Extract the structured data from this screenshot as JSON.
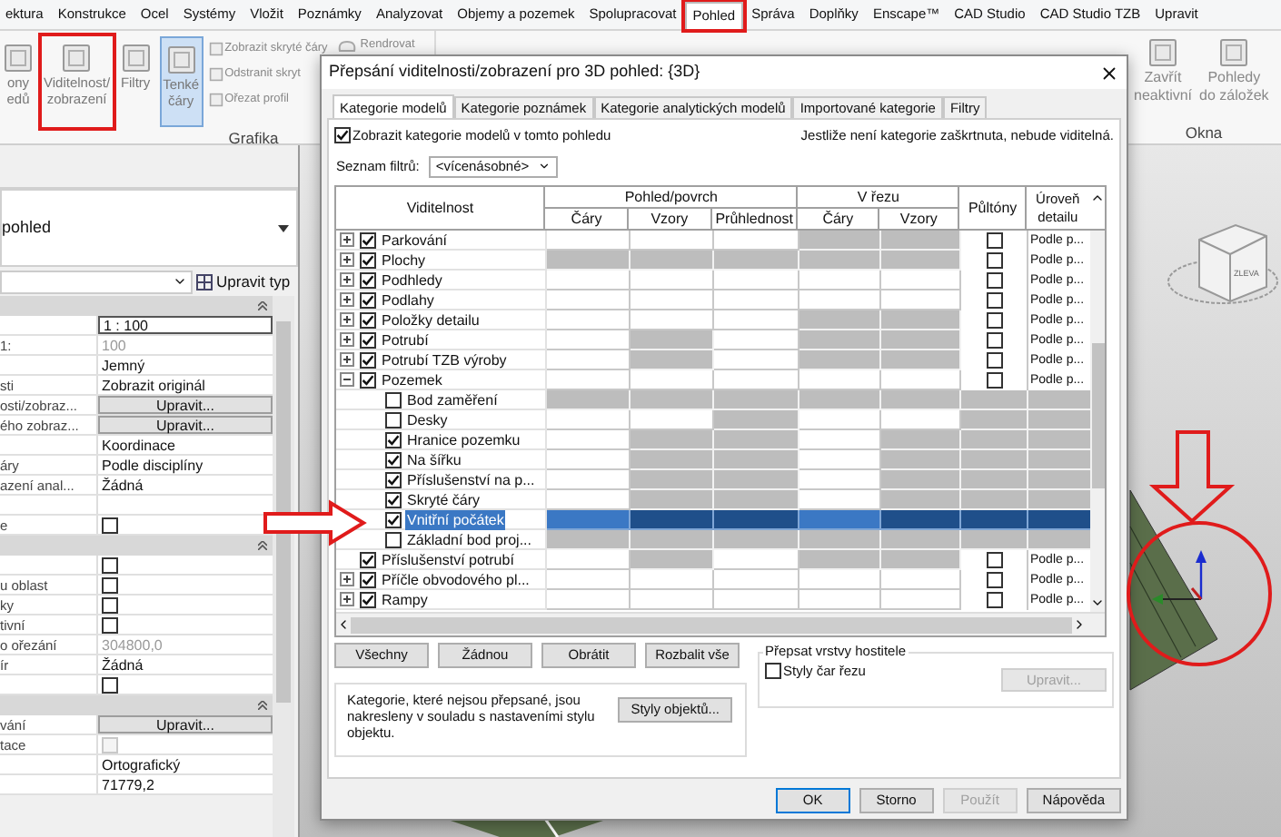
{
  "ribbon": {
    "tabs": [
      {
        "label": "ektura",
        "selected": false,
        "annotated": false
      },
      {
        "label": "Konstrukce",
        "selected": false,
        "annotated": false
      },
      {
        "label": "Ocel",
        "selected": false,
        "annotated": false
      },
      {
        "label": "Systémy",
        "selected": false,
        "annotated": false
      },
      {
        "label": "Vložit",
        "selected": false,
        "annotated": false
      },
      {
        "label": "Poznámky",
        "selected": false,
        "annotated": false
      },
      {
        "label": "Analyzovat",
        "selected": false,
        "annotated": false
      },
      {
        "label": "Objemy a pozemek",
        "selected": false,
        "annotated": false
      },
      {
        "label": "Spolupracovat",
        "selected": false,
        "annotated": false
      },
      {
        "label": "Pohled",
        "selected": true,
        "annotated": true
      },
      {
        "label": "Správa",
        "selected": false,
        "annotated": false
      },
      {
        "label": "Doplňky",
        "selected": false,
        "annotated": false
      },
      {
        "label": "Enscape™",
        "selected": false,
        "annotated": false
      },
      {
        "label": "CAD Studio",
        "selected": false,
        "annotated": false
      },
      {
        "label": "CAD Studio TZB",
        "selected": false,
        "annotated": false
      },
      {
        "label": "Upravit",
        "selected": false,
        "annotated": false
      }
    ],
    "graphics_panel": {
      "label": "Grafika",
      "large_buttons": [
        {
          "label": "ony\nedů",
          "selected": false,
          "annotated": false
        },
        {
          "label": "Viditelnost/\nzobrazení",
          "selected": false,
          "annotated": true
        },
        {
          "label": "Filtry",
          "selected": false,
          "annotated": false
        },
        {
          "label": "Tenké\nčáry",
          "selected": true,
          "annotated": false
        }
      ],
      "small_buttons": [
        "Zobrazit skryté čáry",
        "Odstranit skryt",
        "Ořezat profil"
      ],
      "render_button": "Rendrovat"
    },
    "windows_panel": {
      "label": "Okna",
      "buttons": [
        "Zavřít\nneaktivní",
        "Pohledy\ndo záložek"
      ]
    }
  },
  "properties": {
    "type_name": "pohled",
    "edit_type": "Upravit typ",
    "sections": [
      {
        "rows": [
          {
            "kind": "input",
            "value": "1 : 100",
            "disabled": false
          },
          {
            "kind": "text",
            "label": "1:",
            "value": "100",
            "disabled": true
          },
          {
            "kind": "text",
            "value": "Jemný",
            "disabled": false
          },
          {
            "kind": "text",
            "label": "sti",
            "value": "Zobrazit originál",
            "disabled": false
          },
          {
            "kind": "button",
            "label": "osti/zobraz...",
            "value": "Upravit...",
            "disabled": false
          },
          {
            "kind": "button",
            "label": "ého zobraz...",
            "value": "Upravit...",
            "disabled": false
          },
          {
            "kind": "text",
            "value": "Koordinace",
            "disabled": false
          },
          {
            "kind": "text",
            "label": "áry",
            "value": "Podle disciplíny",
            "disabled": false
          },
          {
            "kind": "text",
            "label": "azení anal...",
            "value": "Žádná",
            "disabled": false
          },
          {
            "kind": "text"
          },
          {
            "kind": "checkbox",
            "label": "e",
            "checked": false,
            "disabled": false
          }
        ]
      },
      {
        "rows": [
          {
            "kind": "checkbox",
            "checked": false,
            "disabled": false
          },
          {
            "kind": "checkbox",
            "label": "u oblast",
            "checked": false,
            "disabled": false
          },
          {
            "kind": "checkbox",
            "label": "ky",
            "checked": false,
            "disabled": false
          },
          {
            "kind": "checkbox",
            "label": "tivní",
            "checked": false,
            "disabled": false
          },
          {
            "kind": "text",
            "label": "o ořezání",
            "value": "304800,0",
            "disabled": true
          },
          {
            "kind": "text",
            "label": "ír",
            "value": "Žádná",
            "disabled": false
          },
          {
            "kind": "checkbox",
            "checked": false,
            "disabled": false
          }
        ]
      },
      {
        "rows": [
          {
            "kind": "button",
            "label": "vání",
            "value": "Upravit...",
            "disabled": false
          },
          {
            "kind": "checkbox",
            "label": "tace",
            "checked": false,
            "disabled": true
          },
          {
            "kind": "text",
            "value": "Ortografický",
            "disabled": false
          },
          {
            "kind": "text",
            "value": "71779,2",
            "disabled": false
          }
        ]
      }
    ]
  },
  "view_cube": {
    "face": "ZLEVA"
  },
  "dialog": {
    "title": "Přepsání viditelnosti/zobrazení pro 3D pohled: {3D}",
    "tabs": [
      {
        "label": "Kategorie modelů",
        "selected": true
      },
      {
        "label": "Kategorie poznámek",
        "selected": false
      },
      {
        "label": "Kategorie analytických modelů",
        "selected": false
      },
      {
        "label": "Importované kategorie",
        "selected": false
      },
      {
        "label": "Filtry",
        "selected": false
      }
    ],
    "show_categories": {
      "label": "Zobrazit kategorie modelů v tomto pohledu",
      "checked": true
    },
    "hint": "Jestliže není kategorie zaškrtnuta, nebude viditelná.",
    "filter_list": {
      "label": "Seznam filtrů:",
      "value": "<vícenásobné>"
    },
    "columns": {
      "visibility": "Viditelnost",
      "surface": "Pohled/povrch",
      "surface_sub": [
        "Čáry",
        "Vzory",
        "Průhlednost"
      ],
      "cut": "V řezu",
      "cut_sub": [
        "Čáry",
        "Vzory"
      ],
      "halftone": "Půltóny",
      "detail": "Úroveň\ndetailu"
    },
    "rows": [
      {
        "label": "Parkování",
        "checked": true,
        "expanded": false,
        "selected": false,
        "cells": [
          {
            "disabled": false
          },
          {
            "disabled": false
          },
          {
            "disabled": false
          },
          {
            "disabled": true
          },
          {
            "disabled": true
          }
        ],
        "halftone": false,
        "detail": "Podle p..."
      },
      {
        "label": "Plochy",
        "checked": true,
        "expanded": false,
        "selected": false,
        "cells": [
          {
            "disabled": true
          },
          {
            "disabled": true
          },
          {
            "disabled": true
          },
          {
            "disabled": true
          },
          {
            "disabled": true
          }
        ],
        "halftone": false,
        "detail": "Podle p..."
      },
      {
        "label": "Podhledy",
        "checked": true,
        "expanded": false,
        "selected": false,
        "cells": [
          {
            "disabled": false
          },
          {
            "disabled": false
          },
          {
            "disabled": false
          },
          {
            "disabled": false
          },
          {
            "disabled": false
          }
        ],
        "halftone": false,
        "detail": "Podle p..."
      },
      {
        "label": "Podlahy",
        "checked": true,
        "expanded": false,
        "selected": false,
        "cells": [
          {
            "disabled": false
          },
          {
            "disabled": false
          },
          {
            "disabled": false
          },
          {
            "disabled": false
          },
          {
            "disabled": false
          }
        ],
        "halftone": false,
        "detail": "Podle p..."
      },
      {
        "label": "Položky detailu",
        "checked": true,
        "expanded": false,
        "selected": false,
        "cells": [
          {
            "disabled": false
          },
          {
            "disabled": false
          },
          {
            "disabled": false
          },
          {
            "disabled": true
          },
          {
            "disabled": true
          }
        ],
        "halftone": false,
        "detail": "Podle p..."
      },
      {
        "label": "Potrubí",
        "checked": true,
        "expanded": false,
        "selected": false,
        "cells": [
          {
            "disabled": false
          },
          {
            "disabled": true
          },
          {
            "disabled": false
          },
          {
            "disabled": true
          },
          {
            "disabled": true
          }
        ],
        "halftone": false,
        "detail": "Podle p..."
      },
      {
        "label": "Potrubí TZB výroby",
        "checked": true,
        "expanded": false,
        "selected": false,
        "cells": [
          {
            "disabled": false
          },
          {
            "disabled": true
          },
          {
            "disabled": false
          },
          {
            "disabled": true
          },
          {
            "disabled": true
          }
        ],
        "halftone": false,
        "detail": "Podle p..."
      },
      {
        "label": "Pozemek",
        "checked": true,
        "expanded": true,
        "selected": false,
        "cells": [
          {
            "disabled": false
          },
          {
            "disabled": false
          },
          {
            "disabled": false
          },
          {
            "disabled": false
          },
          {
            "disabled": false
          }
        ],
        "halftone": false,
        "detail": "Podle p...",
        "children": [
          {
            "label": "Bod zaměření",
            "checked": false,
            "selected": false,
            "cells": [
              {
                "disabled": true
              },
              {
                "disabled": true
              },
              {
                "disabled": true
              },
              {
                "disabled": true
              },
              {
                "disabled": true
              }
            ]
          },
          {
            "label": "Desky",
            "checked": false,
            "selected": false,
            "cells": [
              {
                "disabled": false
              },
              {
                "disabled": false
              },
              {
                "disabled": true
              },
              {
                "disabled": false
              },
              {
                "disabled": false
              }
            ]
          },
          {
            "label": "Hranice pozemku",
            "checked": true,
            "selected": false,
            "cells": [
              {
                "disabled": false
              },
              {
                "disabled": true
              },
              {
                "disabled": true
              },
              {
                "disabled": false
              },
              {
                "disabled": true
              }
            ]
          },
          {
            "label": "Na šířku",
            "checked": true,
            "selected": false,
            "cells": [
              {
                "disabled": false
              },
              {
                "disabled": true
              },
              {
                "disabled": true
              },
              {
                "disabled": false
              },
              {
                "disabled": true
              }
            ]
          },
          {
            "label": "Příslušenství na p...",
            "checked": true,
            "selected": false,
            "cells": [
              {
                "disabled": false
              },
              {
                "disabled": true
              },
              {
                "disabled": true
              },
              {
                "disabled": false
              },
              {
                "disabled": true
              }
            ]
          },
          {
            "label": "Skryté čáry",
            "checked": true,
            "selected": false,
            "cells": [
              {
                "disabled": false
              },
              {
                "disabled": true
              },
              {
                "disabled": true
              },
              {
                "disabled": false
              },
              {
                "disabled": true
              }
            ]
          },
          {
            "label": "Vnitřní počátek",
            "checked": true,
            "selected": true,
            "cells": [
              {
                "disabled": false
              },
              {
                "disabled": true
              },
              {
                "disabled": true
              },
              {
                "disabled": false
              },
              {
                "disabled": true
              }
            ]
          },
          {
            "label": "Základní bod proj...",
            "checked": false,
            "selected": false,
            "cells": [
              {
                "disabled": true
              },
              {
                "disabled": true
              },
              {
                "disabled": true
              },
              {
                "disabled": true
              },
              {
                "disabled": true
              }
            ]
          }
        ]
      },
      {
        "label": "Příslušenství potrubí",
        "checked": true,
        "selected": false,
        "cells": [
          {
            "disabled": false
          },
          {
            "disabled": true
          },
          {
            "disabled": false
          },
          {
            "disabled": true
          },
          {
            "disabled": true
          }
        ],
        "halftone": false,
        "detail": "Podle p..."
      },
      {
        "label": "Příčle obvodového pl...",
        "checked": true,
        "expanded": false,
        "selected": false,
        "cells": [
          {
            "disabled": false
          },
          {
            "disabled": false
          },
          {
            "disabled": false
          },
          {
            "disabled": false
          },
          {
            "disabled": false
          }
        ],
        "halftone": false,
        "detail": "Podle p..."
      },
      {
        "label": "Rampy",
        "checked": true,
        "expanded": false,
        "selected": false,
        "cells": [
          {
            "disabled": false
          },
          {
            "disabled": false
          },
          {
            "disabled": false
          },
          {
            "disabled": false
          },
          {
            "disabled": false
          }
        ],
        "halftone": false,
        "detail": "Podle p..."
      }
    ],
    "buttons": [
      "Všechny",
      "Žádnou",
      "Obrátit",
      "Rozbalit vše"
    ],
    "info": "Kategorie, které nejsou přepsané, jsou nakresleny v souladu s nastaveními stylu objektu.",
    "object_styles_button": "Styly objektů...",
    "host_layers": {
      "title": "Přepsat vrstvy hostitele",
      "checkbox": {
        "label": "Styly čar řezu",
        "checked": false
      },
      "edit_button": {
        "label": "Upravit...",
        "disabled": true
      }
    },
    "footer_buttons": [
      {
        "label": "OK",
        "disabled": false,
        "focused": true
      },
      {
        "label": "Storno",
        "disabled": false,
        "focused": false
      },
      {
        "label": "Použít",
        "disabled": true,
        "focused": false
      },
      {
        "label": "Nápověda",
        "disabled": false,
        "focused": false
      }
    ]
  }
}
